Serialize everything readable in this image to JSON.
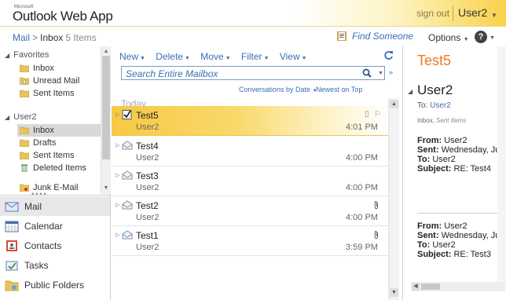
{
  "header": {
    "brand_small": "Microsoft",
    "brand": "Outlook Web App",
    "sign_out": "sign out",
    "user": "User2"
  },
  "nav": {
    "breadcrumb_root": "Mail",
    "breadcrumb_sep": ">",
    "breadcrumb_current": "Inbox",
    "item_count": "5 Items",
    "find_someone": "Find Someone",
    "options": "Options",
    "help": "?"
  },
  "folders": {
    "favorites_header": "Favorites",
    "favorites": [
      "Inbox",
      "Unread Mail",
      "Sent Items"
    ],
    "mailbox_header": "User2",
    "mailbox": [
      "Inbox",
      "Drafts",
      "Sent Items",
      "Deleted Items",
      "Junk E-Mail"
    ],
    "selected": "Inbox"
  },
  "modules": [
    {
      "label": "Mail",
      "icon": "mail-icon",
      "selected": true
    },
    {
      "label": "Calendar",
      "icon": "calendar-icon",
      "selected": false
    },
    {
      "label": "Contacts",
      "icon": "contacts-icon",
      "selected": false
    },
    {
      "label": "Tasks",
      "icon": "tasks-icon",
      "selected": false
    },
    {
      "label": "Public Folders",
      "icon": "public-folders-icon",
      "selected": false
    }
  ],
  "toolbar": {
    "new": "New",
    "delete": "Delete",
    "move": "Move",
    "filter": "Filter",
    "view": "View"
  },
  "search": {
    "placeholder": "Search Entire Mailbox"
  },
  "sort": {
    "arrange": "Conversations by Date",
    "order": "Newest on Top"
  },
  "list": {
    "group": "Today",
    "messages": [
      {
        "subject": "Test5",
        "from": "User2",
        "time": "4:01 PM",
        "selected": true,
        "attachment": false
      },
      {
        "subject": "Test4",
        "from": "User2",
        "time": "4:00 PM",
        "selected": false,
        "attachment": false
      },
      {
        "subject": "Test3",
        "from": "User2",
        "time": "4:00 PM",
        "selected": false,
        "attachment": false
      },
      {
        "subject": "Test2",
        "from": "User2",
        "time": "4:00 PM",
        "selected": false,
        "attachment": true
      },
      {
        "subject": "Test1",
        "from": "User2",
        "time": "3:59 PM",
        "selected": false,
        "attachment": true
      }
    ]
  },
  "reading": {
    "title": "Test5",
    "sender": "User2",
    "to_label": "To:",
    "to_value": "User2",
    "folder_info": "Inbox,",
    "folder_info2": "Sent Items",
    "messages": [
      {
        "from_label": "From:",
        "from": "User2",
        "sent_label": "Sent:",
        "sent": "Wednesday, Ju",
        "to_label": "To:",
        "to": "User2",
        "subject_label": "Subject:",
        "subject": "RE: Test4"
      },
      {
        "from_label": "From:",
        "from": "User2",
        "sent_label": "Sent:",
        "sent": "Wednesday, Ju",
        "to_label": "To:",
        "to": "User2",
        "subject_label": "Subject:",
        "subject": "RE: Test3"
      }
    ]
  },
  "colors": {
    "accent_blue": "#3b6fb6",
    "title_orange": "#f07a1e",
    "selection_gold": "#f7c843"
  }
}
